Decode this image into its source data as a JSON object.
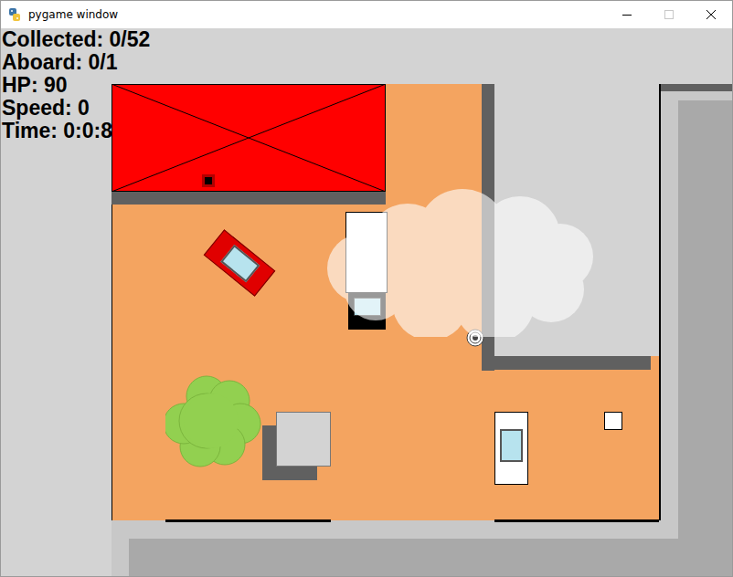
{
  "window": {
    "title": "pygame window",
    "controls": [
      {
        "kind": "minimize",
        "disabled": false
      },
      {
        "kind": "maximize",
        "disabled": true
      },
      {
        "kind": "close",
        "disabled": false
      }
    ]
  },
  "hud": [
    "Collected: 0/52",
    "Aboard: 0/1",
    "HP: 90",
    "Speed: 0",
    "Time: 0:0:8"
  ]
}
